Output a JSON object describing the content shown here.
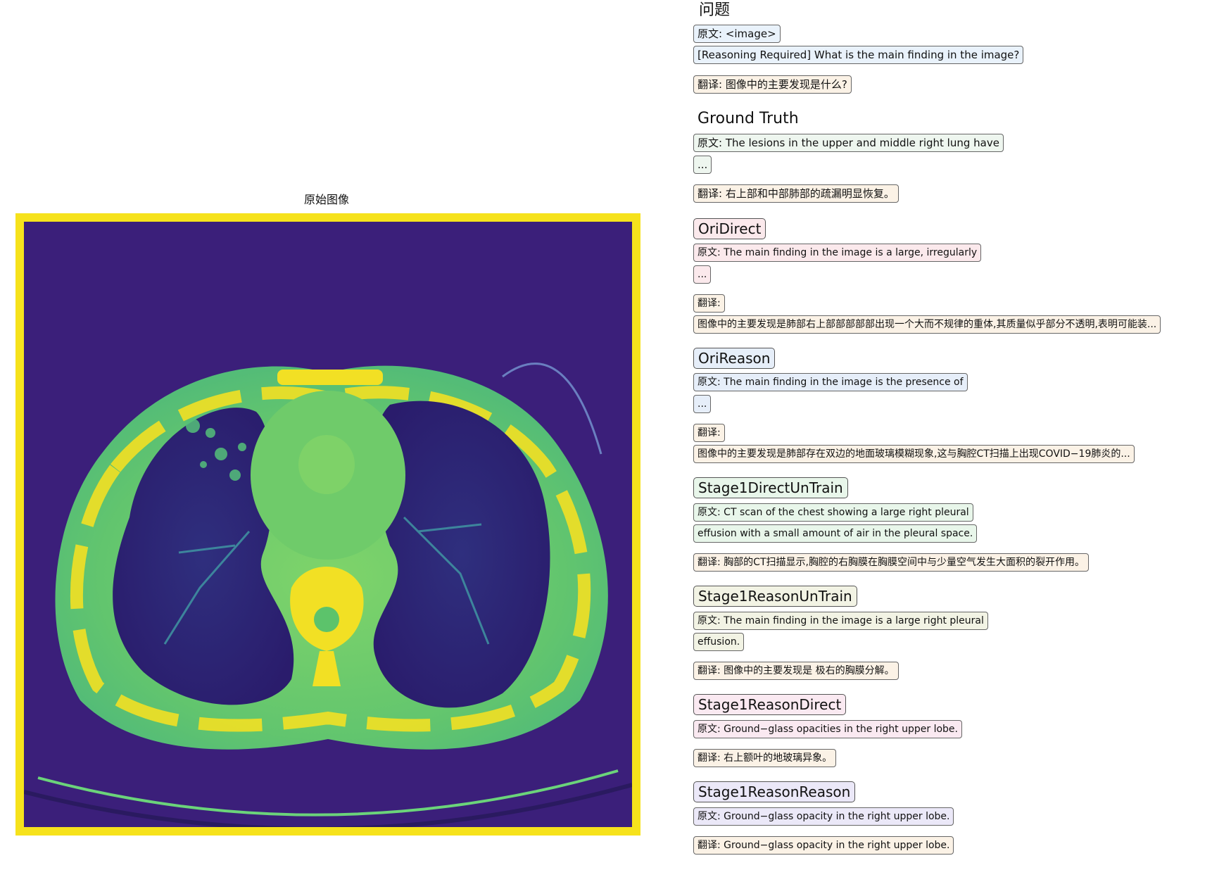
{
  "image_title": "原始图像",
  "question": {
    "heading": "问题",
    "orig_1": "原文: <image>",
    "orig_2": "[Reasoning Required] What is the main finding in the image?",
    "trans": "翻译: 图像中的主要发现是什么?"
  },
  "ground_truth": {
    "heading": "Ground Truth",
    "orig": "原文: The lesions in the upper and middle right lung have",
    "ellipsis": "...",
    "trans": "翻译: 右上部和中部肺部的疏漏明显恢复。"
  },
  "ori_direct": {
    "tag": "OriDirect",
    "orig": "原文: The main finding in the image is a large, irregularly",
    "ellipsis": "...",
    "trans_label": "翻译:",
    "trans": "图像中的主要发现是肺部右上部部部部部出现一个大而不规律的重体,其质量似乎部分不透明,表明可能装..."
  },
  "ori_reason": {
    "tag": "OriReason",
    "orig": "原文: The main finding in the image is the presence of",
    "ellipsis": "...",
    "trans_label": "翻译:",
    "trans": "图像中的主要发现是肺部存在双边的地面玻璃模糊现象,这与胸腔CT扫描上出现COVID−19肺炎的..."
  },
  "stage1_direct_untrain": {
    "tag": "Stage1DirectUnTrain",
    "orig_1": "原文: CT scan of the chest showing a large right pleural",
    "orig_2": "effusion with a small amount of air in the pleural space.",
    "trans": "翻译: 胸部的CT扫描显示,胸腔的右胸膜在胸膜空间中与少量空气发生大面积的裂开作用。"
  },
  "stage1_reason_untrain": {
    "tag": "Stage1ReasonUnTrain",
    "orig_1": "原文: The main finding in the image is a large right pleural",
    "orig_2": "effusion.",
    "trans": "翻译: 图像中的主要发现是 极右的胸膜分解。"
  },
  "stage1_reason_direct": {
    "tag": "Stage1ReasonDirect",
    "orig": "原文: Ground−glass opacities in the right upper lobe.",
    "trans": "翻译: 右上额叶的地玻璃异象。"
  },
  "stage1_reason_reason": {
    "tag": "Stage1ReasonReason",
    "orig": "原文: Ground−glass opacity in the right upper lobe.",
    "trans": "翻译: Ground−glass opacity in the right upper lobe."
  },
  "colors": {
    "frame": "#f6e21c",
    "ct_background": "#3b1f7a",
    "ct_tissue": "#5cc36b",
    "ct_bone": "#f2e024",
    "ct_lung": "#33216e"
  }
}
